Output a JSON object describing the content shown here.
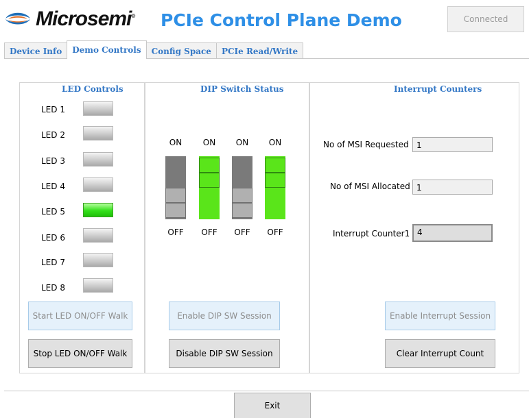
{
  "header": {
    "brand_name": "Microsemi",
    "brand_mark": "®",
    "app_title": "PCIe Control Plane Demo",
    "connection_status": "Connected",
    "logo_icon": "microsemi-logo-icon"
  },
  "tabs": [
    {
      "label": "Device Info",
      "active": false
    },
    {
      "label": "Demo Controls",
      "active": true
    },
    {
      "label": "Config Space",
      "active": false
    },
    {
      "label": "PCIe Read/Write",
      "active": false
    }
  ],
  "led_controls": {
    "title": "LED Controls",
    "leds": [
      {
        "label": "LED 1",
        "on": false
      },
      {
        "label": "LED 2",
        "on": false
      },
      {
        "label": "LED 3",
        "on": false
      },
      {
        "label": "LED 4",
        "on": false
      },
      {
        "label": "LED 5",
        "on": true
      },
      {
        "label": "LED 6",
        "on": false
      },
      {
        "label": "LED 7",
        "on": false
      },
      {
        "label": "LED 8",
        "on": false
      }
    ],
    "start_button": "Start LED ON/OFF Walk",
    "stop_button": "Stop LED ON/OFF Walk"
  },
  "dip_switches": {
    "title": "DIP Switch Status",
    "on_label": "ON",
    "off_label": "OFF",
    "switches": [
      {
        "state": "OFF",
        "color": "#7a7a7a"
      },
      {
        "state": "ON",
        "color": "#5ae51a"
      },
      {
        "state": "OFF",
        "color": "#7a7a7a"
      },
      {
        "state": "ON",
        "color": "#5ae51a"
      }
    ],
    "enable_button": "Enable DIP SW Session",
    "disable_button": "Disable DIP SW Session"
  },
  "interrupts": {
    "title": "Interrupt Counters",
    "msi_requested_label": "No of MSI Requested",
    "msi_requested_value": "1",
    "msi_allocated_label": "No of MSI Allocated",
    "msi_allocated_value": "1",
    "counter_label": "Interrupt Counter1",
    "counter_value": "4",
    "enable_button": "Enable Interrupt Session",
    "clear_button": "Clear Interrupt Count"
  },
  "footer": {
    "exit_button": "Exit"
  },
  "colors": {
    "accent_blue": "#3478c6",
    "title_blue": "#2e8fe6",
    "led_on_green": "#33e01a",
    "dip_on_green": "#5ae51a"
  }
}
